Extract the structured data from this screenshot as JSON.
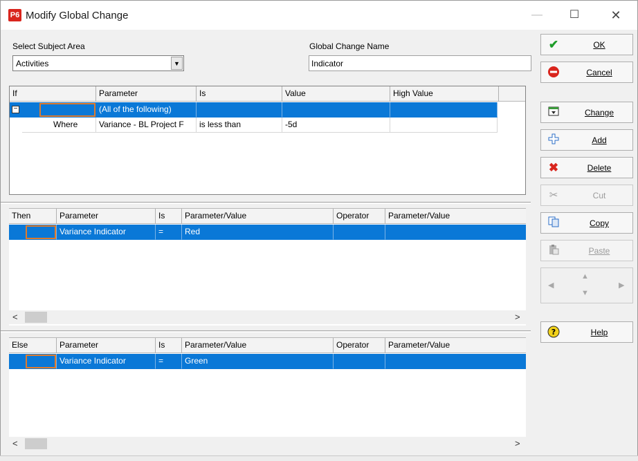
{
  "window": {
    "logo": "P6",
    "title": "Modify Global Change",
    "minimize_icon": "—",
    "maximize_icon": "☐",
    "close_icon": "✕"
  },
  "form": {
    "subject_area_label": "Select Subject Area",
    "subject_area_value": "Activities",
    "global_change_name_label": "Global Change Name",
    "global_change_name_value": "Indicator"
  },
  "if_grid": {
    "columns": [
      "If",
      "Parameter",
      "Is",
      "Value",
      "High Value"
    ],
    "rows": [
      {
        "where": "",
        "parameter": "(All of the following)",
        "is": "",
        "value": "",
        "high_value": ""
      },
      {
        "where": "Where",
        "parameter": "Variance - BL Project F",
        "is": "is less than",
        "value": "-5d",
        "high_value": ""
      }
    ]
  },
  "then_grid": {
    "columns": [
      "Then",
      "Parameter",
      "Is",
      "Parameter/Value",
      "Operator",
      "Parameter/Value"
    ],
    "rows": [
      {
        "parameter": "Variance Indicator",
        "is": "=",
        "value": "Red",
        "operator": "",
        "value2": ""
      }
    ]
  },
  "else_grid": {
    "columns": [
      "Else",
      "Parameter",
      "Is",
      "Parameter/Value",
      "Operator",
      "Parameter/Value"
    ],
    "rows": [
      {
        "parameter": "Variance Indicator",
        "is": "=",
        "value": "Green",
        "operator": "",
        "value2": ""
      }
    ]
  },
  "scroll": {
    "left_arrow": "<",
    "right_arrow": ">"
  },
  "buttons": {
    "ok": "OK",
    "cancel": "Cancel",
    "change": "Change",
    "add": "Add",
    "delete": "Delete",
    "cut": "Cut",
    "copy": "Copy",
    "paste": "Paste",
    "help": "Help"
  },
  "icons": {
    "ok": "checkmark-icon",
    "cancel": "no-entry-icon",
    "change": "change-icon",
    "add": "plus-icon",
    "delete": "x-icon",
    "cut": "scissors-icon",
    "copy": "copy-icon",
    "paste": "paste-icon",
    "help": "question-icon"
  },
  "colors": {
    "selection": "#0a78d7",
    "focus_outline": "#e07b2c",
    "logo": "#d9251d"
  }
}
